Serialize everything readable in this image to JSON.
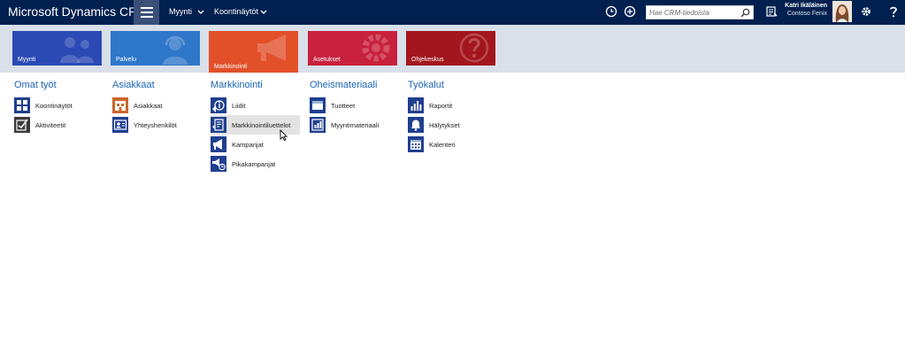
{
  "header": {
    "brand": "Microsoft Dynamics CRM",
    "breadcrumb": [
      {
        "label": "Myynti"
      },
      {
        "label": "Koontinäytöt"
      }
    ],
    "search": {
      "placeholder": "Hae CRM-tiedoista",
      "value": ""
    },
    "user": {
      "name": "Katri Ikäläinen",
      "organization": "Contoso Fenix"
    },
    "icons": [
      "menu-icon",
      "recent-icon",
      "new-record-icon",
      "search-icon",
      "advanced-find-icon",
      "settings-icon",
      "help-icon"
    ],
    "colors": {
      "bar": "#002050",
      "menu_button": "#3a5079"
    }
  },
  "tiles": [
    {
      "label": "Myynti",
      "color": "#2b4ab4",
      "icon": "people-icon"
    },
    {
      "label": "Palvelu",
      "color": "#2f77c9",
      "icon": "headset-person-icon"
    },
    {
      "label": "Markkinointi",
      "color": "#e2502a",
      "icon": "megaphone-icon",
      "selected": true
    },
    {
      "label": "Asetukset",
      "color": "#c8213d",
      "icon": "gear-icon"
    },
    {
      "label": "Ohjekeskus",
      "color": "#a3161d",
      "icon": "question-icon"
    }
  ],
  "groups": [
    {
      "title": "Omat työt",
      "items": [
        {
          "label": "Koontinäytöt",
          "icon": "dashboard-icon"
        },
        {
          "label": "Aktiviteetit",
          "icon": "activities-icon"
        }
      ]
    },
    {
      "title": "Asiakkaat",
      "items": [
        {
          "label": "Asiakkaat",
          "icon": "account-icon"
        },
        {
          "label": "Yhteyshenkilöt",
          "icon": "contact-icon"
        }
      ]
    },
    {
      "title": "Markkinointi",
      "items": [
        {
          "label": "Liidit",
          "icon": "lead-icon"
        },
        {
          "label": "Markkinointiluettelot",
          "icon": "marketing-list-icon",
          "hover": true
        },
        {
          "label": "Kampanjat",
          "icon": "campaign-icon"
        },
        {
          "label": "Pikakampanjat",
          "icon": "quick-campaign-icon"
        }
      ]
    },
    {
      "title": "Oheismateriaali",
      "items": [
        {
          "label": "Tuotteet",
          "icon": "product-icon"
        },
        {
          "label": "Myyntimateriaali",
          "icon": "sales-literature-icon"
        }
      ]
    },
    {
      "title": "Työkalut",
      "items": [
        {
          "label": "Raportit",
          "icon": "report-icon"
        },
        {
          "label": "Hälytykset",
          "icon": "alert-bell-icon"
        },
        {
          "label": "Kalenteri",
          "icon": "calendar-icon"
        }
      ]
    }
  ],
  "colors": {
    "group_title": "#1a64b2",
    "icon_blue": "#1f3f8f",
    "icon_orange": "#c9682a",
    "icon_dark": "#3a3a3a",
    "hover": "#e3e3e3"
  }
}
